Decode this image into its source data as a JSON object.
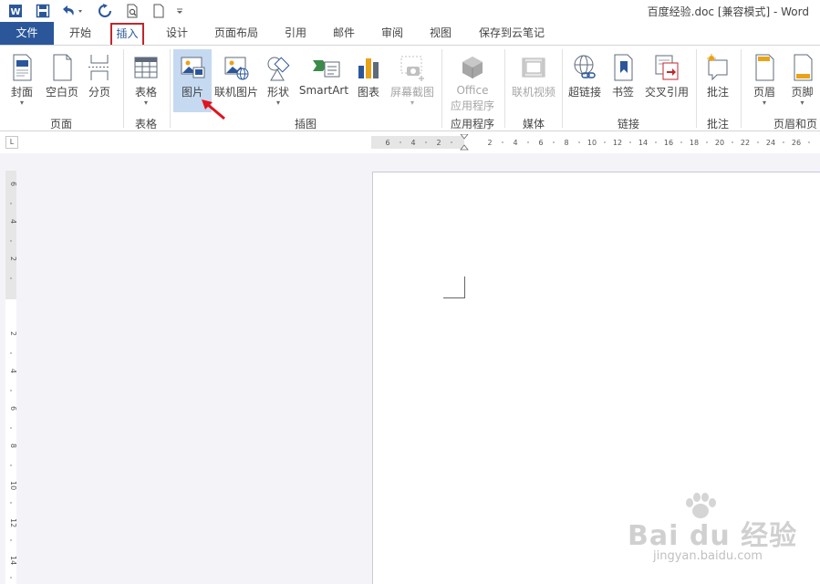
{
  "window": {
    "title": "百度经验.doc [兼容模式] - Word"
  },
  "tabs": [
    {
      "label": "文件"
    },
    {
      "label": "开始"
    },
    {
      "label": "插入"
    },
    {
      "label": "设计"
    },
    {
      "label": "页面布局"
    },
    {
      "label": "引用"
    },
    {
      "label": "邮件"
    },
    {
      "label": "审阅"
    },
    {
      "label": "视图"
    },
    {
      "label": "保存到云笔记"
    }
  ],
  "active_tab": "插入",
  "ribbon": {
    "groups": [
      {
        "label": "页面"
      },
      {
        "label": "表格"
      },
      {
        "label": "插图"
      },
      {
        "label": "应用程序"
      },
      {
        "label": "媒体"
      },
      {
        "label": "链接"
      },
      {
        "label": "批注"
      },
      {
        "label": "页眉和页"
      }
    ],
    "buttons": {
      "cover": "封面",
      "blank_page": "空白页",
      "page_break": "分页",
      "table": "表格",
      "picture": "图片",
      "online_picture": "联机图片",
      "shapes": "形状",
      "smartart": "SmartArt",
      "chart": "图表",
      "screenshot": "屏幕截图",
      "office_line1": "Office",
      "office_line2": "应用程序",
      "online_video": "联机视频",
      "hyperlink": "超链接",
      "bookmark": "书签",
      "cross_reference": "交叉引用",
      "comment": "批注",
      "header": "页眉",
      "footer": "页脚"
    },
    "dropdown_caret": "▾"
  },
  "ruler": {
    "corner": "L",
    "horizontal_ticks": [
      "6",
      "4",
      "2",
      "2",
      "4",
      "6",
      "8",
      "10",
      "12",
      "14",
      "16",
      "18",
      "20",
      "22",
      "24",
      "26"
    ],
    "vertical_ticks": [
      "6",
      "4",
      "2",
      "2",
      "4",
      "6",
      "8",
      "10",
      "12",
      "14"
    ]
  },
  "watermark": {
    "brand": "Bai du 经验",
    "url": "jingyan.baidu.com"
  },
  "colors": {
    "file_tab": "#2b579a",
    "active_tab_outline": "#c0272d",
    "selected_button": "#c5d9f1",
    "arrow": "#e0141e"
  },
  "icons": [
    "word-logo-icon",
    "save-icon",
    "undo-icon",
    "redo-icon",
    "print-preview-icon",
    "new-document-icon",
    "customize-toolbar-icon"
  ]
}
